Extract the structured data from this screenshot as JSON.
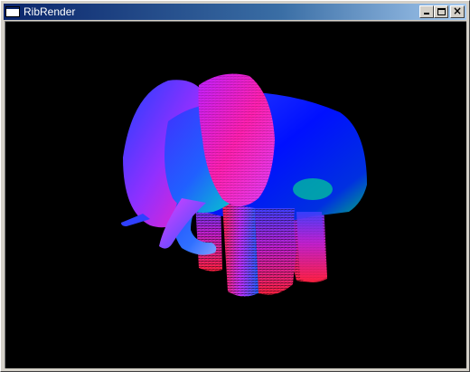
{
  "window": {
    "title": "RibRender",
    "controls": {
      "minimize": "minimize-icon",
      "maximize": "maximize-icon",
      "close": "close-icon"
    }
  },
  "render": {
    "subject": "elephant",
    "colors": {
      "background": "#000000",
      "blue": "#0000ff",
      "magenta": "#ff00ff",
      "green": "#00ff80",
      "red": "#ff2040",
      "cyan": "#00a0ff"
    }
  }
}
